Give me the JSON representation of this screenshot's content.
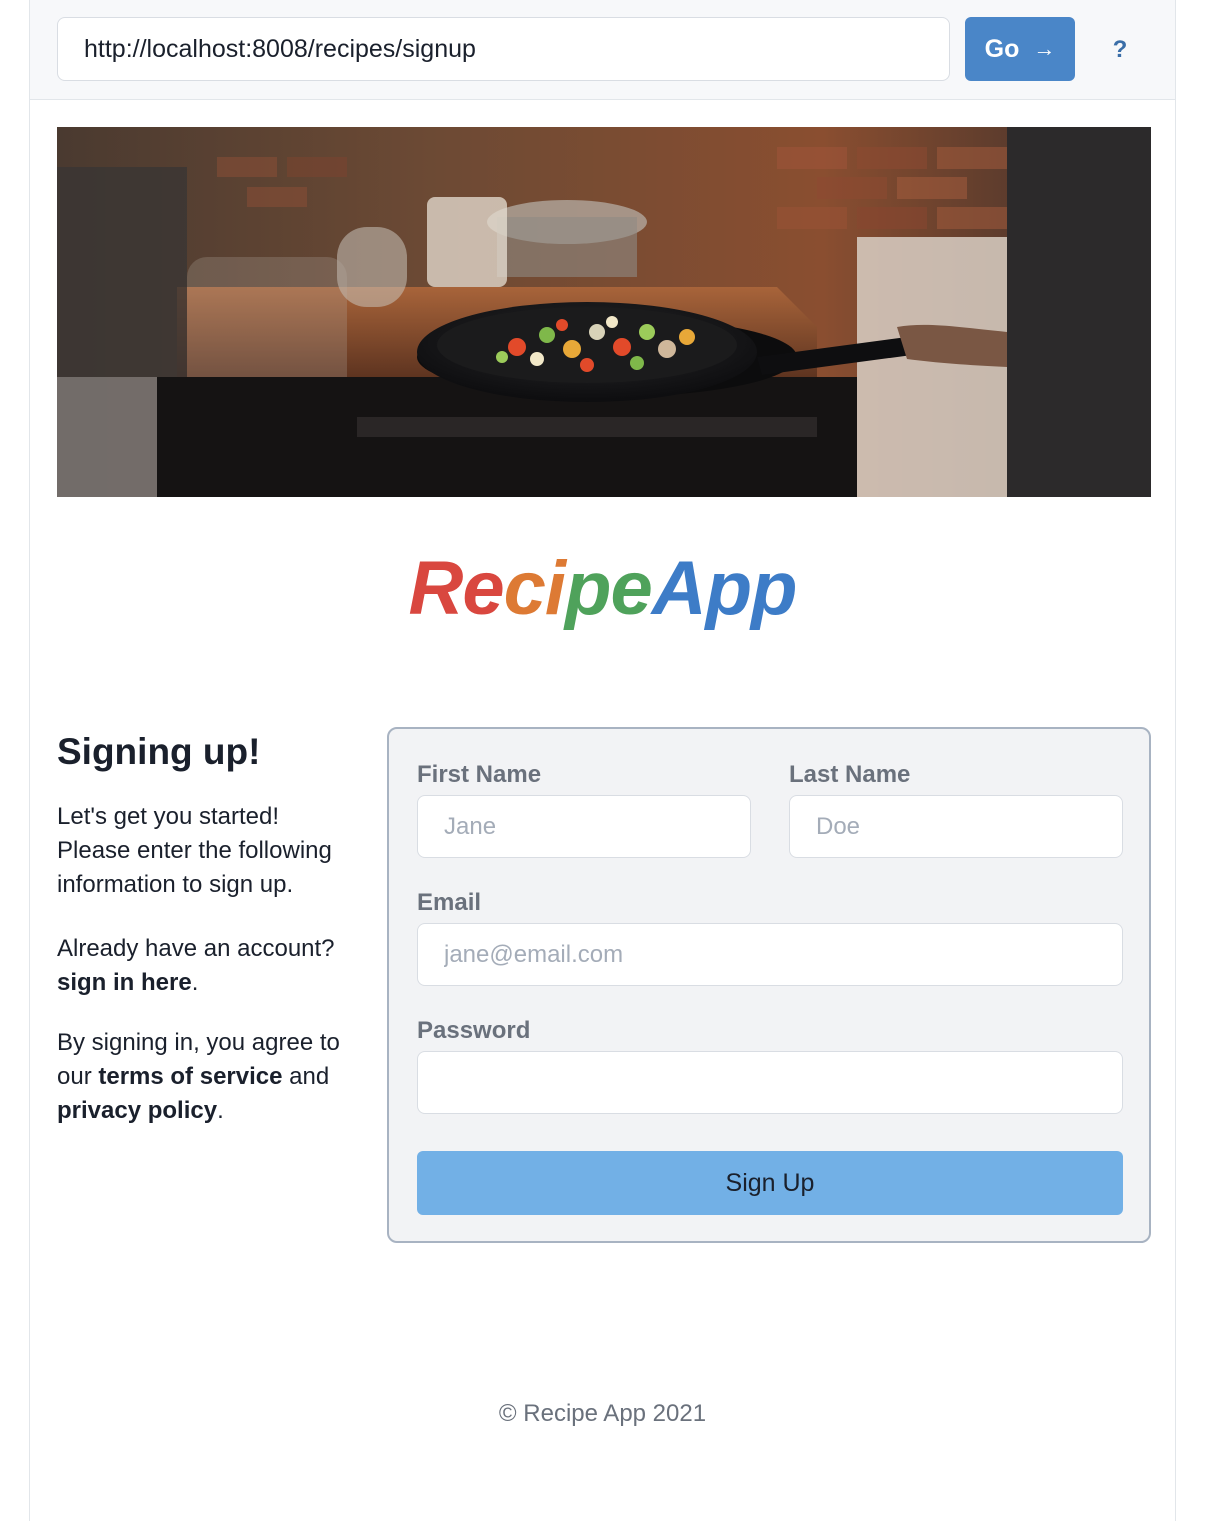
{
  "browser": {
    "url": "http://localhost:8008/recipes/signup",
    "go_label": "Go",
    "go_arrow": "→",
    "help_label": "?"
  },
  "logo": {
    "parts": [
      "Re",
      "ci",
      "pe",
      "App"
    ],
    "colors": [
      "#d9473f",
      "#dd7a34",
      "#4fa25b",
      "#3d7cc7"
    ]
  },
  "intro": {
    "heading": "Signing up!",
    "text": "Let's get you started! Please enter the following information to sign up.",
    "already_prefix": "Already have an account? ",
    "sign_in_link": "sign in here",
    "period": ".",
    "terms_prefix": "By signing in, you agree to our ",
    "terms_link": "terms of service",
    "and_text": " and ",
    "privacy_link": "privacy policy",
    "terms_period": "."
  },
  "form": {
    "first_name_label": "First Name",
    "first_name_placeholder": "Jane",
    "last_name_label": "Last Name",
    "last_name_placeholder": "Doe",
    "email_label": "Email",
    "email_placeholder": "jane@email.com",
    "password_label": "Password",
    "password_placeholder": "",
    "submit_label": "Sign Up"
  },
  "footer": {
    "copyright": "© Recipe App 2021"
  }
}
